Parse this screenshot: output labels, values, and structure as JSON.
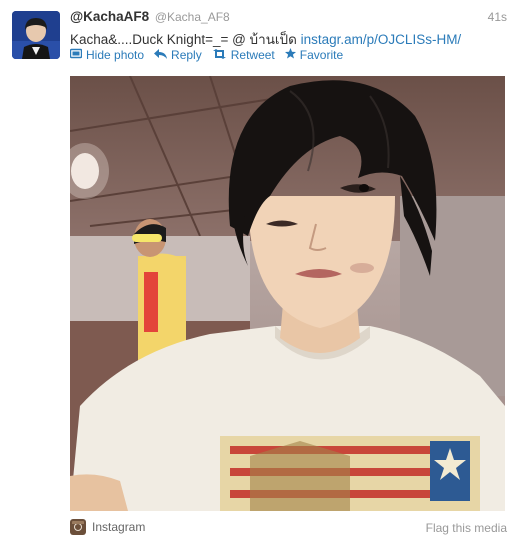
{
  "tweet": {
    "display_name": "@KachaAF8",
    "handle": "@Kacha_AF8",
    "timestamp": "41s",
    "text_plain": "Kacha&....Duck Knight=_= @ บ้านเป็ด ",
    "text_link": "instagr.am/p/OJCLISs-HM/"
  },
  "actions": {
    "hide_photo": "Hide photo",
    "reply": "Reply",
    "retweet": "Retweet",
    "favorite": "Favorite"
  },
  "media": {
    "source_label": "Instagram",
    "flag_label": "Flag this media"
  },
  "colors": {
    "link": "#2b7bb9",
    "muted": "#999999",
    "text": "#333333"
  },
  "icons": {
    "avatar": "user-avatar",
    "hide_photo": "photo-icon",
    "reply": "reply-arrow-icon",
    "retweet": "retweet-icon",
    "favorite": "star-icon",
    "source": "instagram-icon"
  }
}
